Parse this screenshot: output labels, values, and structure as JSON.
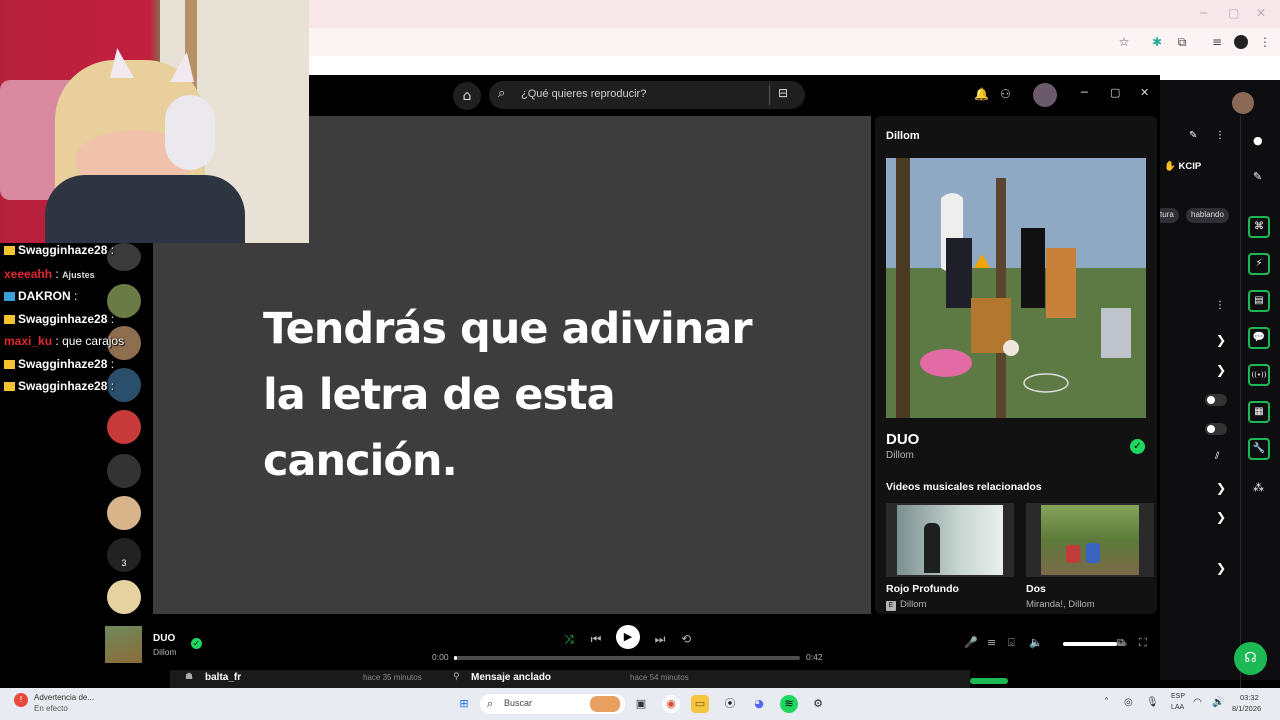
{
  "chrome": {
    "win_min": "─",
    "win_max": "▢",
    "win_close": "✕"
  },
  "chat": [
    {
      "user": "Swagginhaze28",
      "sep": ":",
      "msg": "",
      "crown": true,
      "red": false
    },
    {
      "user": "xeeeahh",
      "sep": ":",
      "msg": "",
      "crown": false,
      "red": true
    },
    {
      "user": "DAKRON",
      "sep": ":",
      "msg": "",
      "crown": true,
      "red": false
    },
    {
      "user": "Swagginhaze28",
      "sep": ":",
      "msg": "",
      "crown": true,
      "red": false
    },
    {
      "user": "maxi_ku",
      "sep": ":",
      "msg": "que carajos",
      "crown": false,
      "red": true
    },
    {
      "user": "Swagginhaze28",
      "sep": ":",
      "msg": "",
      "crown": true,
      "red": false
    },
    {
      "user": "Swagginhaze28",
      "sep": ":",
      "msg": "",
      "crown": true,
      "red": false
    }
  ],
  "chat_overlay": {
    "ajustes": "Ajustes",
    "side_badge": "3"
  },
  "spotify": {
    "search_placeholder": "¿Qué quieres reproducir?",
    "lyrics_lines": [
      "Tendrás que adivinar",
      "la letra de esta",
      "canción."
    ],
    "panel_title": "Dillom",
    "song_title": "DUO",
    "song_artist": "Dillom",
    "related_title": "Videos musicales relacionados",
    "videos": [
      {
        "title": "Rojo Profundo",
        "artist": "Dillom",
        "explicit": "E"
      },
      {
        "title": "Dos",
        "artist": "Miranda!, Dillom",
        "explicit": ""
      }
    ],
    "now_playing": {
      "title": "DUO",
      "artist": "Dillom"
    },
    "time_elapsed": "0:00",
    "time_total": "0:42",
    "progress": 0.01,
    "volume": 0.85,
    "window": {
      "min": "─",
      "max": "▢",
      "close": "✕"
    }
  },
  "rail": {
    "kcip": "KCIP",
    "tags": [
      "tura",
      "hablando"
    ],
    "buttons": [
      "⌘",
      "⚡",
      "▤",
      "💬",
      "((•))",
      "▦",
      "🔧"
    ]
  },
  "chat_footer": [
    {
      "user": "balta_fr",
      "time": "hace 35 minutos"
    },
    {
      "label": "Mensaje anclado",
      "time": "hace 54 minutos"
    }
  ],
  "taskbar": {
    "notification_title": "Advertencia de...",
    "notification_sub": "En efecto",
    "search_label": "Buscar",
    "lang_top": "ESP",
    "lang_bottom": "LAA",
    "clock_time": "03:32",
    "clock_date": "8/1/2026"
  },
  "colors": {
    "spotify_green": "#1ed760",
    "twitch_green": "#1db954",
    "lyrics_bg": "#3d3d3d"
  }
}
